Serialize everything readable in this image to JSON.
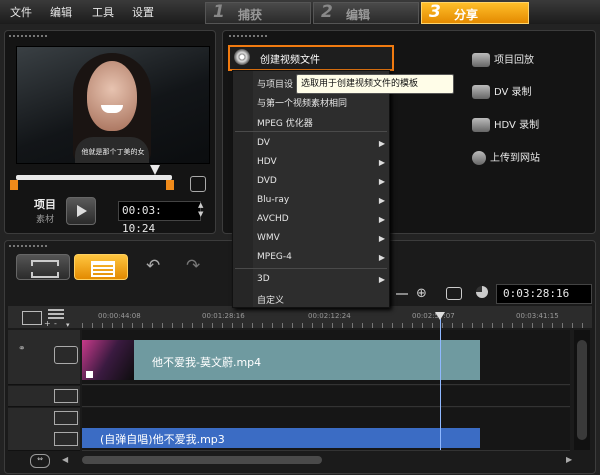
{
  "menu": {
    "file": "文件",
    "edit": "编辑",
    "tools": "工具",
    "settings": "设置"
  },
  "steps": [
    {
      "num": "1",
      "label": "捕获"
    },
    {
      "num": "2",
      "label": "编辑"
    },
    {
      "num": "3",
      "label": "分享"
    }
  ],
  "preview": {
    "subtitle": "他就是那个丁美的女",
    "mode_project": "项目",
    "mode_clip": "素材",
    "timecode": "00:03: 10:24"
  },
  "share": {
    "create_video": "创建视频文件",
    "project_playback": "项目回放",
    "dv_record": "DV 录制",
    "hdv_record": "HDV 录制",
    "upload_web": "上传到网站"
  },
  "tooltip": "选取用于创建视频文件的模板",
  "dropdown": {
    "same_project": "与项目设",
    "same_first_clip": "与第一个视频素材相同",
    "mpeg_optimize": "MPEG 优化器",
    "dv": "DV",
    "hdv": "HDV",
    "dvd": "DVD",
    "bluray": "Blu-ray",
    "avchd": "AVCHD",
    "wmv": "WMV",
    "mpeg4": "MPEG-4",
    "threed": "3D",
    "custom": "自定义"
  },
  "timeline": {
    "duration": "0:03:28:16",
    "ticks": [
      "00:00:44:08",
      "00:01:28:16",
      "00:02:12:24",
      "00:02:57:07",
      "00:03:41:15"
    ],
    "video_clip": "他不爱我-莫文蔚.mp4",
    "audio_clip": "(自弹自唱)他不爱我.mp3",
    "track_plus": "+",
    "track_minus": "-"
  },
  "colors": {
    "accent": "#f08a1a",
    "video_clip": "#6f9aa0",
    "audio_clip": "#3b6cc4"
  }
}
